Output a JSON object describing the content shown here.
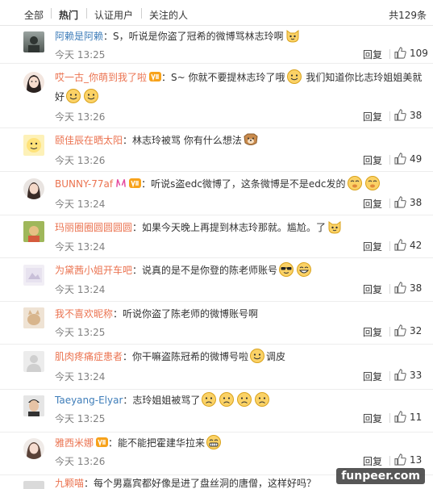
{
  "filter_bar": {
    "tabs": [
      {
        "label": "全部",
        "active": false
      },
      {
        "label": "热门",
        "active": true
      },
      {
        "label": "认证用户",
        "active": false
      },
      {
        "label": "关注的人",
        "active": false
      }
    ],
    "total": "共129条"
  },
  "reply_label": "回复",
  "comments": [
    {
      "user": "阿赖是阿赖",
      "text": "：S，听说是你盗了冠希的微博骂林志玲啊",
      "time": "今天 13:25",
      "likes": "109",
      "name_color": "blue"
    },
    {
      "user": "哎一古_你萌到我了啦",
      "text": "：S~ 你就不要提林志玲了哦",
      "text2": " 我们知道你比志玲姐姐美就好",
      "time": "今天 13:26",
      "likes": "38",
      "name_color": "orange"
    },
    {
      "user": "颐佳辰在晒太阳",
      "text": "：林志玲被骂 你有什么想法",
      "time": "今天 13:26",
      "likes": "49",
      "name_color": "orange"
    },
    {
      "user": "BUNNY-77af",
      "text": "：听说s盗edc微博了，这条微博是不是edc发的",
      "time": "今天 13:24",
      "likes": "38",
      "name_color": "orange"
    },
    {
      "user": "玛丽圈圈圆圆圆圆",
      "text": "：如果今天晚上再提到林志玲那就。尴尬。了",
      "time": "今天 13:24",
      "likes": "42",
      "name_color": "orange"
    },
    {
      "user": "为黛茜小姐开车吧",
      "text": "：说真的是不是你登的陈老师账号",
      "time": "今天 13:24",
      "likes": "38",
      "name_color": "orange"
    },
    {
      "user": "我不喜欢昵称",
      "text": "：听说你盗了陈老师的微博账号啊",
      "time": "今天 13:25",
      "likes": "32",
      "name_color": "orange"
    },
    {
      "user": "肌肉疼痛症患者",
      "text": "：你干嘛盗陈冠希的微博号啦",
      "text2": "调皮",
      "time": "今天 13:24",
      "likes": "33",
      "name_color": "orange"
    },
    {
      "user": "Taeyang-Elyar",
      "text": "：志玲姐姐被骂了",
      "time": "今天 13:25",
      "likes": "11",
      "name_color": "blue"
    },
    {
      "user": "雅西米娜",
      "text": "：能不能把霍建华拉来",
      "time": "今天 13:26",
      "likes": "13",
      "name_color": "orange"
    },
    {
      "user": "九颗喵",
      "text": "：每个男嘉宾都好像是进了盘丝洞的唐僧，这样好吗？",
      "name_color": "orange"
    }
  ],
  "watermark": "funpeer.com",
  "colors": {
    "username_orange": "#eb7350",
    "username_blue": "#3e7db9",
    "meta_gray": "#808080"
  },
  "icons": [
    "thumbs-up-icon",
    "vip-icon",
    "emoji-icon",
    "cat-emoji-icon",
    "cool-emoji-icon",
    "sad-emoji-icon",
    "grin-emoji-icon",
    "shy-emoji-icon"
  ]
}
